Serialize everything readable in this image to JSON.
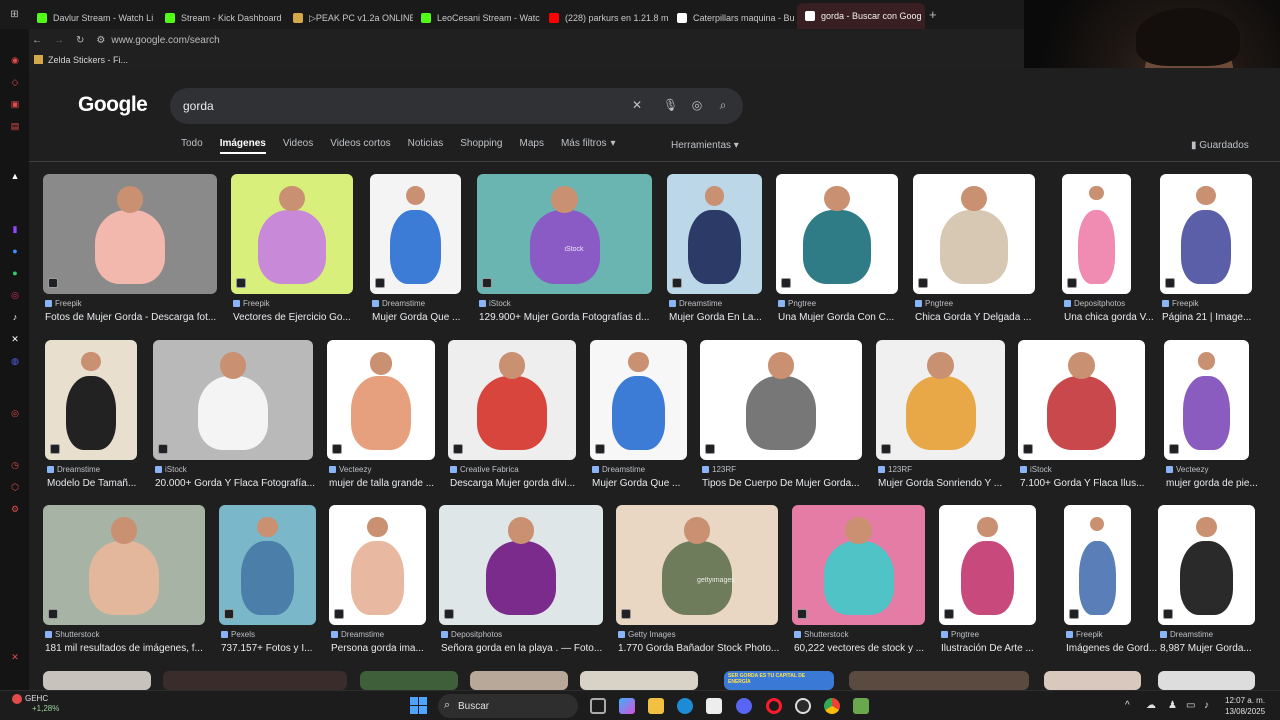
{
  "browser": {
    "tabs": [
      {
        "label": "Davlur Stream - Watch Li",
        "color": "#53fc18"
      },
      {
        "label": "Stream - Kick Dashboard",
        "color": "#53fc18"
      },
      {
        "label": "▷PEAK PC v1.2a ONLINE",
        "color": "#d4a84a"
      },
      {
        "label": "LeoCesani Stream - Watc",
        "color": "#53fc18"
      },
      {
        "label": "(228) parkurs en 1.21.8 m",
        "color": "#ff0000"
      },
      {
        "label": "Caterpillars maquina - Bu",
        "color": "#ffffff"
      },
      {
        "label": "gorda - Buscar con Goog",
        "color": "#ffffff"
      }
    ],
    "new_tab": "+",
    "url": "www.google.com/search",
    "bookmark": "Zelda Stickers - Fi..."
  },
  "google": {
    "logo": "Google",
    "query": "gorda",
    "nav": [
      "Todo",
      "Imágenes",
      "Videos",
      "Videos cortos",
      "Noticias",
      "Shopping",
      "Maps",
      "Más filtros"
    ],
    "active_nav_index": 1,
    "tools": "Herramientas",
    "saved": "Guardados"
  },
  "results": [
    [
      {
        "source": "Freepik",
        "caption": "Fotos de Mujer Gorda - Descarga fot...",
        "bg": "#8a8a8a",
        "fig": "#f2b8ae"
      },
      {
        "source": "Freepik",
        "caption": "Vectores de Ejercicio Go...",
        "bg": "#d8ef7c",
        "fig": "#c88ad8"
      },
      {
        "source": "Dreamstime",
        "caption": "Mujer Gorda Que ...",
        "bg": "#f4f4f4",
        "fig": "#3c7bd6"
      },
      {
        "source": "iStock",
        "caption": "129.900+ Mujer Gorda Fotografías d...",
        "bg": "#6ab5b2",
        "fig": "#8a5bc4",
        "watermark": "iStock"
      },
      {
        "source": "Dreamstime",
        "caption": "Mujer Gorda En La...",
        "bg": "#bcd7e8",
        "fig": "#2b3a66"
      },
      {
        "source": "Pngtree",
        "caption": "Una Mujer Gorda Con C...",
        "bg": "#ffffff",
        "fig": "#2f7c86"
      },
      {
        "source": "Pngtree",
        "caption": "Chica Gorda Y Delgada ...",
        "bg": "#ffffff",
        "fig": "#d7c8b4"
      },
      {
        "source": "Depositphotos",
        "caption": "Una chica gorda V...",
        "bg": "#ffffff",
        "fig": "#f08bb2"
      },
      {
        "source": "Freepik",
        "caption": "Página 21 | Image...",
        "bg": "#ffffff",
        "fig": "#5a5fa8"
      }
    ],
    [
      {
        "source": "Dreamstime",
        "caption": "Modelo De Tamañ...",
        "bg": "#e8dfcf",
        "fig": "#222222"
      },
      {
        "source": "iStock",
        "caption": "20.000+ Gorda Y Flaca Fotografía...",
        "bg": "#b9b9b9",
        "fig": "#f4f4f4"
      },
      {
        "source": "Vecteezy",
        "caption": "mujer de talla grande ...",
        "bg": "#ffffff",
        "fig": "#e7a07e"
      },
      {
        "source": "Creative Fabrica",
        "caption": "Descarga Mujer gorda divi...",
        "bg": "#eeeeee",
        "fig": "#d8453c"
      },
      {
        "source": "Dreamstime",
        "caption": "Mujer Gorda Que ...",
        "bg": "#f7f7f7",
        "fig": "#3c7bd6"
      },
      {
        "source": "123RF",
        "caption": "Tipos De Cuerpo De Mujer Gorda...",
        "bg": "#ffffff",
        "fig": "#777777"
      },
      {
        "source": "123RF",
        "caption": "Mujer Gorda Sonriendo Y ...",
        "bg": "#f0f0f0",
        "fig": "#e8a847"
      },
      {
        "source": "iStock",
        "caption": "7.100+ Gorda Y Flaca Ilus...",
        "bg": "#ffffff",
        "fig": "#c8484c"
      },
      {
        "source": "Vecteezy",
        "caption": "mujer gorda de pie...",
        "bg": "#ffffff",
        "fig": "#8b5cc0"
      }
    ],
    [
      {
        "source": "Shutterstock",
        "caption": "181 mil resultados de imágenes, f...",
        "bg": "#a6b3a5",
        "fig": "#e3b79c"
      },
      {
        "source": "Pexels",
        "caption": "737.157+ Fotos y I...",
        "bg": "#7ab8c9",
        "fig": "#4b7ea8"
      },
      {
        "source": "Dreamstime",
        "caption": "Persona gorda ima...",
        "bg": "#ffffff",
        "fig": "#e8b8a0"
      },
      {
        "source": "Depositphotos",
        "caption": "Señora gorda en la playa . — Foto...",
        "bg": "#dfe6e8",
        "fig": "#7b2b8c"
      },
      {
        "source": "Getty Images",
        "caption": "1.770 Gorda Bañador Stock Photo...",
        "bg": "#e9d6c3",
        "fig": "#6e7c5c",
        "watermark": "gettyimages"
      },
      {
        "source": "Shutterstock",
        "caption": "60,222 vectores de stock y ...",
        "bg": "#e57ca6",
        "fig": "#4fc3c6"
      },
      {
        "source": "Pngtree",
        "caption": "Ilustración De Arte ...",
        "bg": "#ffffff",
        "fig": "#c84a7c"
      },
      {
        "source": "Freepik",
        "caption": "Imágenes de Gord...",
        "bg": "#ffffff",
        "fig": "#5a7fb8"
      },
      {
        "source": "Dreamstime",
        "caption": "8,987 Mujer Gorda...",
        "bg": "#ffffff",
        "fig": "#2a2a2a"
      }
    ]
  ],
  "bottom_row_overlay": "SER GORDA ES TU CAPITAL DE ENERGÍA",
  "taskbar": {
    "weather_name": "GEHC",
    "weather_change": "+1,28%",
    "search_placeholder": "Buscar",
    "time": "12:07 a. m.",
    "date": "13/08/2025"
  }
}
